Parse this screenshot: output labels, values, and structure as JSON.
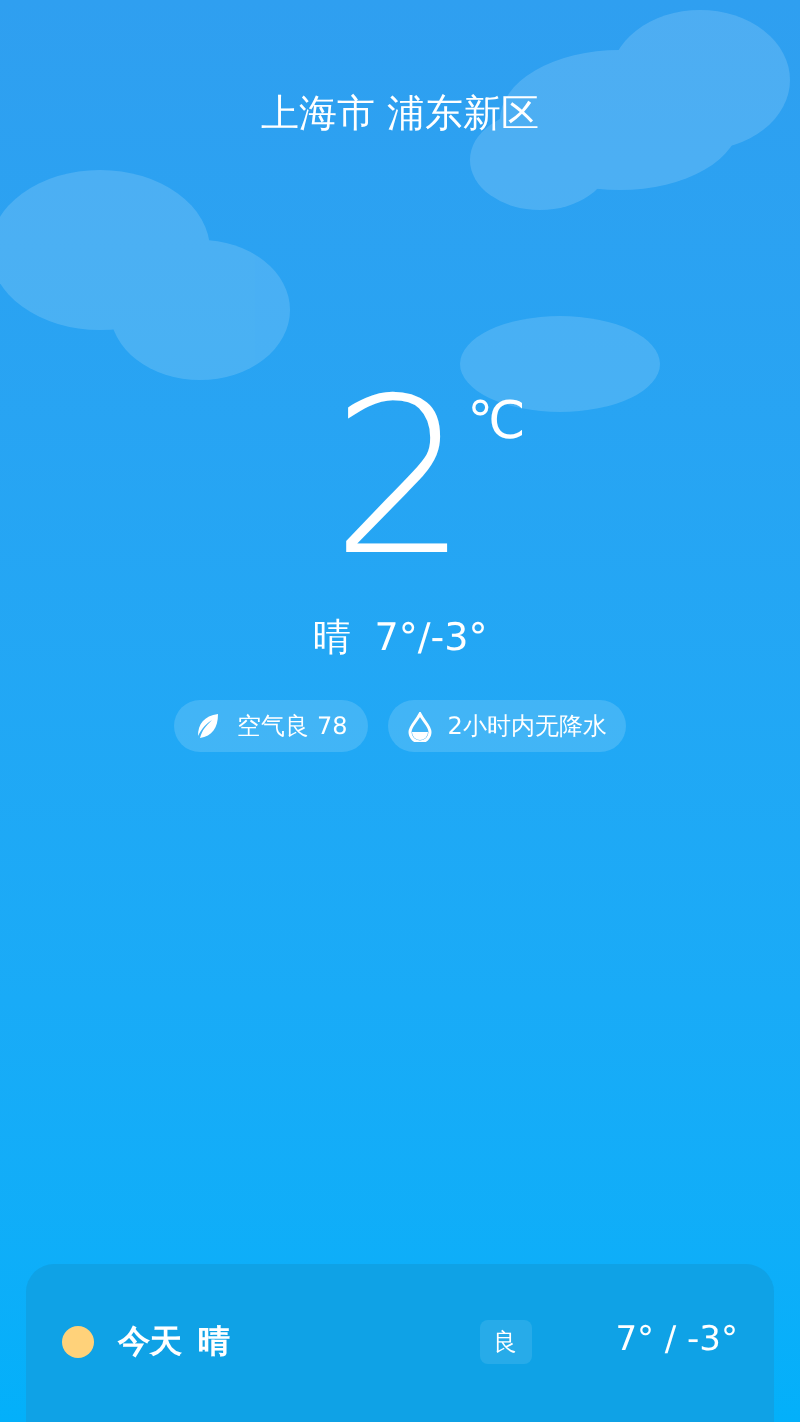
{
  "location": "上海市 浦东新区",
  "current": {
    "temperature": "2",
    "unit": "℃",
    "condition": "晴",
    "range": "7°/-3°"
  },
  "pills": [
    {
      "kind": "air",
      "text": "空气良 78"
    },
    {
      "kind": "rain",
      "text": "2小时内无降水"
    }
  ],
  "forecast": [
    {
      "day": "今天",
      "condition": "晴",
      "air": "良",
      "range": "7° / -3°"
    }
  ]
}
